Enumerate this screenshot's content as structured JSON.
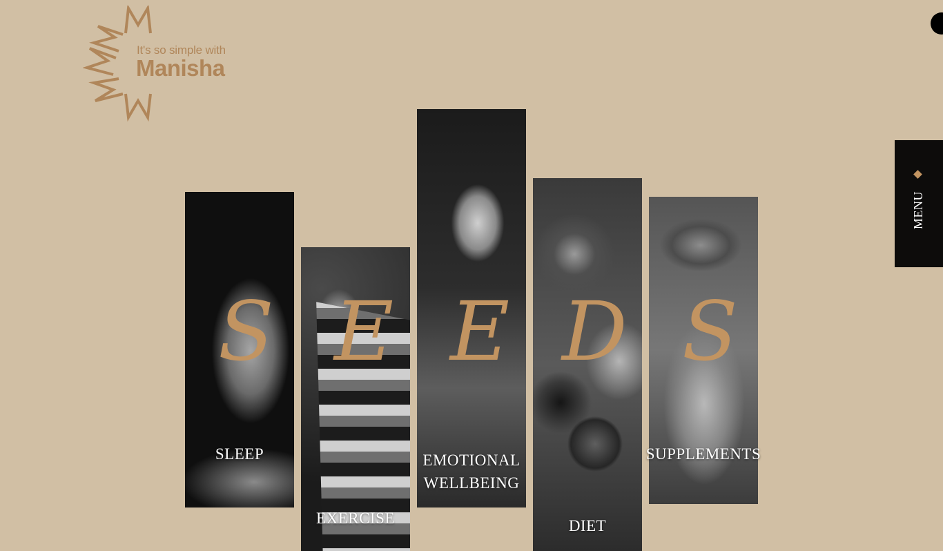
{
  "brand": {
    "tagline": "It's so simple with",
    "name": "Manisha",
    "logo_mark_letter": "M",
    "logo_color": "#b0865a"
  },
  "menu": {
    "label": "MENU",
    "icon": "diamond-icon"
  },
  "hero_word": [
    "S",
    "E",
    "E",
    "D",
    "S"
  ],
  "panels": [
    {
      "label": "SLEEP"
    },
    {
      "label": "EXERCISE"
    },
    {
      "label_line1": "EMOTIONAL",
      "label_line2": "WELLBEING"
    },
    {
      "label": "DIET"
    },
    {
      "label": "SUPPLEMENTS"
    }
  ],
  "colors": {
    "background": "#d1bfa4",
    "accent": "#c29461",
    "menu_bg": "#0d0c0b"
  }
}
